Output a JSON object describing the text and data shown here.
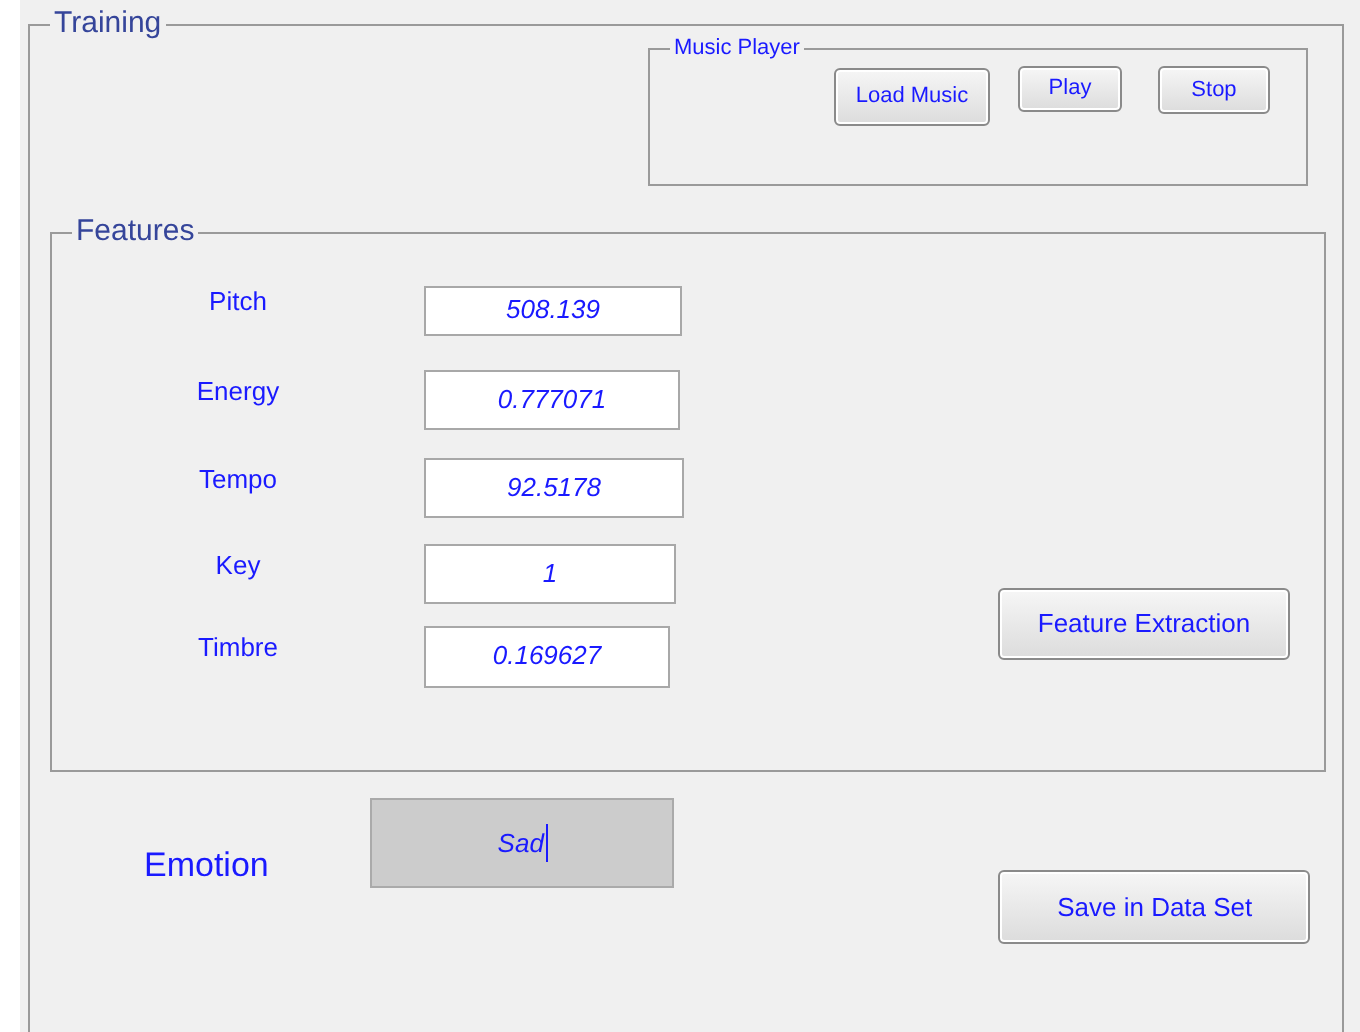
{
  "training": {
    "title": "Training"
  },
  "music_player": {
    "title": "Music Player",
    "buttons": [
      "Load Music",
      "Play",
      "Stop"
    ]
  },
  "features": {
    "title": "Features",
    "fields": [
      {
        "label": "Pitch",
        "value": "508.139"
      },
      {
        "label": "Energy",
        "value": "0.777071"
      },
      {
        "label": "Tempo",
        "value": "92.5178"
      },
      {
        "label": "Key",
        "value": "1"
      },
      {
        "label": "Timbre",
        "value": "0.169627"
      }
    ],
    "button": "Feature Extraction"
  },
  "emotion": {
    "label": "Emotion",
    "value": "Sad"
  },
  "save_button": "Save in Data Set"
}
